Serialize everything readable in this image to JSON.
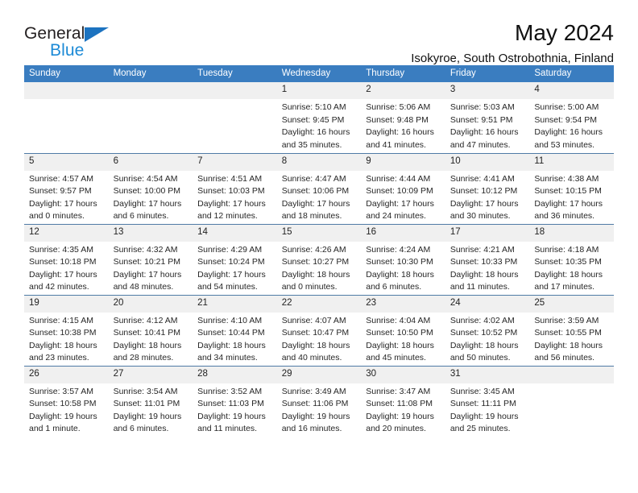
{
  "brand": {
    "name_top": "General",
    "name_bottom": "Blue",
    "triangle_color": "#1c73c0",
    "blue_text_color": "#1c8ad6"
  },
  "header": {
    "title": "May 2024",
    "subtitle": "Isokyroe, South Ostrobothnia, Finland"
  },
  "theme": {
    "header_row_bg": "#3a7dc0",
    "daynum_bg": "#f0f0f0",
    "week_divider": "#4f7ba6"
  },
  "calendar": {
    "weekday_headers": [
      "Sunday",
      "Monday",
      "Tuesday",
      "Wednesday",
      "Thursday",
      "Friday",
      "Saturday"
    ],
    "labels": {
      "sunrise": "Sunrise:",
      "sunset": "Sunset:",
      "daylight": "Daylight:"
    },
    "weeks": [
      [
        {
          "day": "",
          "blank": true,
          "line1": "",
          "line2": "",
          "line3": "",
          "line4": ""
        },
        {
          "day": "",
          "blank": true,
          "line1": "",
          "line2": "",
          "line3": "",
          "line4": ""
        },
        {
          "day": "",
          "blank": true,
          "line1": "",
          "line2": "",
          "line3": "",
          "line4": ""
        },
        {
          "day": "1",
          "blank": false,
          "line1": "Sunrise: 5:10 AM",
          "line2": "Sunset: 9:45 PM",
          "line3": "Daylight: 16 hours",
          "line4": "and 35 minutes."
        },
        {
          "day": "2",
          "blank": false,
          "line1": "Sunrise: 5:06 AM",
          "line2": "Sunset: 9:48 PM",
          "line3": "Daylight: 16 hours",
          "line4": "and 41 minutes."
        },
        {
          "day": "3",
          "blank": false,
          "line1": "Sunrise: 5:03 AM",
          "line2": "Sunset: 9:51 PM",
          "line3": "Daylight: 16 hours",
          "line4": "and 47 minutes."
        },
        {
          "day": "4",
          "blank": false,
          "line1": "Sunrise: 5:00 AM",
          "line2": "Sunset: 9:54 PM",
          "line3": "Daylight: 16 hours",
          "line4": "and 53 minutes."
        }
      ],
      [
        {
          "day": "5",
          "blank": false,
          "line1": "Sunrise: 4:57 AM",
          "line2": "Sunset: 9:57 PM",
          "line3": "Daylight: 17 hours",
          "line4": "and 0 minutes."
        },
        {
          "day": "6",
          "blank": false,
          "line1": "Sunrise: 4:54 AM",
          "line2": "Sunset: 10:00 PM",
          "line3": "Daylight: 17 hours",
          "line4": "and 6 minutes."
        },
        {
          "day": "7",
          "blank": false,
          "line1": "Sunrise: 4:51 AM",
          "line2": "Sunset: 10:03 PM",
          "line3": "Daylight: 17 hours",
          "line4": "and 12 minutes."
        },
        {
          "day": "8",
          "blank": false,
          "line1": "Sunrise: 4:47 AM",
          "line2": "Sunset: 10:06 PM",
          "line3": "Daylight: 17 hours",
          "line4": "and 18 minutes."
        },
        {
          "day": "9",
          "blank": false,
          "line1": "Sunrise: 4:44 AM",
          "line2": "Sunset: 10:09 PM",
          "line3": "Daylight: 17 hours",
          "line4": "and 24 minutes."
        },
        {
          "day": "10",
          "blank": false,
          "line1": "Sunrise: 4:41 AM",
          "line2": "Sunset: 10:12 PM",
          "line3": "Daylight: 17 hours",
          "line4": "and 30 minutes."
        },
        {
          "day": "11",
          "blank": false,
          "line1": "Sunrise: 4:38 AM",
          "line2": "Sunset: 10:15 PM",
          "line3": "Daylight: 17 hours",
          "line4": "and 36 minutes."
        }
      ],
      [
        {
          "day": "12",
          "blank": false,
          "line1": "Sunrise: 4:35 AM",
          "line2": "Sunset: 10:18 PM",
          "line3": "Daylight: 17 hours",
          "line4": "and 42 minutes."
        },
        {
          "day": "13",
          "blank": false,
          "line1": "Sunrise: 4:32 AM",
          "line2": "Sunset: 10:21 PM",
          "line3": "Daylight: 17 hours",
          "line4": "and 48 minutes."
        },
        {
          "day": "14",
          "blank": false,
          "line1": "Sunrise: 4:29 AM",
          "line2": "Sunset: 10:24 PM",
          "line3": "Daylight: 17 hours",
          "line4": "and 54 minutes."
        },
        {
          "day": "15",
          "blank": false,
          "line1": "Sunrise: 4:26 AM",
          "line2": "Sunset: 10:27 PM",
          "line3": "Daylight: 18 hours",
          "line4": "and 0 minutes."
        },
        {
          "day": "16",
          "blank": false,
          "line1": "Sunrise: 4:24 AM",
          "line2": "Sunset: 10:30 PM",
          "line3": "Daylight: 18 hours",
          "line4": "and 6 minutes."
        },
        {
          "day": "17",
          "blank": false,
          "line1": "Sunrise: 4:21 AM",
          "line2": "Sunset: 10:33 PM",
          "line3": "Daylight: 18 hours",
          "line4": "and 11 minutes."
        },
        {
          "day": "18",
          "blank": false,
          "line1": "Sunrise: 4:18 AM",
          "line2": "Sunset: 10:35 PM",
          "line3": "Daylight: 18 hours",
          "line4": "and 17 minutes."
        }
      ],
      [
        {
          "day": "19",
          "blank": false,
          "line1": "Sunrise: 4:15 AM",
          "line2": "Sunset: 10:38 PM",
          "line3": "Daylight: 18 hours",
          "line4": "and 23 minutes."
        },
        {
          "day": "20",
          "blank": false,
          "line1": "Sunrise: 4:12 AM",
          "line2": "Sunset: 10:41 PM",
          "line3": "Daylight: 18 hours",
          "line4": "and 28 minutes."
        },
        {
          "day": "21",
          "blank": false,
          "line1": "Sunrise: 4:10 AM",
          "line2": "Sunset: 10:44 PM",
          "line3": "Daylight: 18 hours",
          "line4": "and 34 minutes."
        },
        {
          "day": "22",
          "blank": false,
          "line1": "Sunrise: 4:07 AM",
          "line2": "Sunset: 10:47 PM",
          "line3": "Daylight: 18 hours",
          "line4": "and 40 minutes."
        },
        {
          "day": "23",
          "blank": false,
          "line1": "Sunrise: 4:04 AM",
          "line2": "Sunset: 10:50 PM",
          "line3": "Daylight: 18 hours",
          "line4": "and 45 minutes."
        },
        {
          "day": "24",
          "blank": false,
          "line1": "Sunrise: 4:02 AM",
          "line2": "Sunset: 10:52 PM",
          "line3": "Daylight: 18 hours",
          "line4": "and 50 minutes."
        },
        {
          "day": "25",
          "blank": false,
          "line1": "Sunrise: 3:59 AM",
          "line2": "Sunset: 10:55 PM",
          "line3": "Daylight: 18 hours",
          "line4": "and 56 minutes."
        }
      ],
      [
        {
          "day": "26",
          "blank": false,
          "line1": "Sunrise: 3:57 AM",
          "line2": "Sunset: 10:58 PM",
          "line3": "Daylight: 19 hours",
          "line4": "and 1 minute."
        },
        {
          "day": "27",
          "blank": false,
          "line1": "Sunrise: 3:54 AM",
          "line2": "Sunset: 11:01 PM",
          "line3": "Daylight: 19 hours",
          "line4": "and 6 minutes."
        },
        {
          "day": "28",
          "blank": false,
          "line1": "Sunrise: 3:52 AM",
          "line2": "Sunset: 11:03 PM",
          "line3": "Daylight: 19 hours",
          "line4": "and 11 minutes."
        },
        {
          "day": "29",
          "blank": false,
          "line1": "Sunrise: 3:49 AM",
          "line2": "Sunset: 11:06 PM",
          "line3": "Daylight: 19 hours",
          "line4": "and 16 minutes."
        },
        {
          "day": "30",
          "blank": false,
          "line1": "Sunrise: 3:47 AM",
          "line2": "Sunset: 11:08 PM",
          "line3": "Daylight: 19 hours",
          "line4": "and 20 minutes."
        },
        {
          "day": "31",
          "blank": false,
          "line1": "Sunrise: 3:45 AM",
          "line2": "Sunset: 11:11 PM",
          "line3": "Daylight: 19 hours",
          "line4": "and 25 minutes."
        },
        {
          "day": "",
          "blank": true,
          "line1": "",
          "line2": "",
          "line3": "",
          "line4": ""
        }
      ]
    ]
  }
}
